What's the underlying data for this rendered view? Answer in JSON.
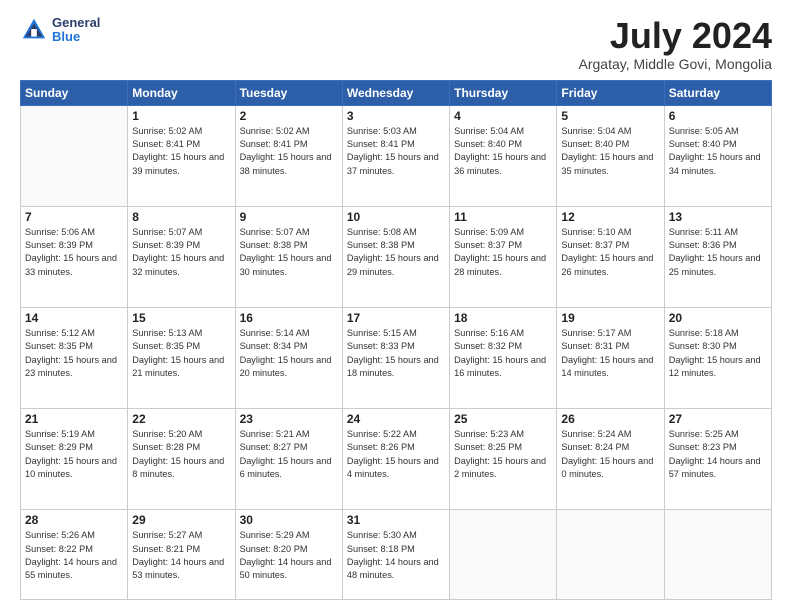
{
  "logo": {
    "general": "General",
    "blue": "Blue"
  },
  "header": {
    "month": "July 2024",
    "location": "Argatay, Middle Govi, Mongolia"
  },
  "weekdays": [
    "Sunday",
    "Monday",
    "Tuesday",
    "Wednesday",
    "Thursday",
    "Friday",
    "Saturday"
  ],
  "weeks": [
    [
      {
        "day": "",
        "sunrise": "",
        "sunset": "",
        "daylight": ""
      },
      {
        "day": "1",
        "sunrise": "Sunrise: 5:02 AM",
        "sunset": "Sunset: 8:41 PM",
        "daylight": "Daylight: 15 hours and 39 minutes."
      },
      {
        "day": "2",
        "sunrise": "Sunrise: 5:02 AM",
        "sunset": "Sunset: 8:41 PM",
        "daylight": "Daylight: 15 hours and 38 minutes."
      },
      {
        "day": "3",
        "sunrise": "Sunrise: 5:03 AM",
        "sunset": "Sunset: 8:41 PM",
        "daylight": "Daylight: 15 hours and 37 minutes."
      },
      {
        "day": "4",
        "sunrise": "Sunrise: 5:04 AM",
        "sunset": "Sunset: 8:40 PM",
        "daylight": "Daylight: 15 hours and 36 minutes."
      },
      {
        "day": "5",
        "sunrise": "Sunrise: 5:04 AM",
        "sunset": "Sunset: 8:40 PM",
        "daylight": "Daylight: 15 hours and 35 minutes."
      },
      {
        "day": "6",
        "sunrise": "Sunrise: 5:05 AM",
        "sunset": "Sunset: 8:40 PM",
        "daylight": "Daylight: 15 hours and 34 minutes."
      }
    ],
    [
      {
        "day": "7",
        "sunrise": "Sunrise: 5:06 AM",
        "sunset": "Sunset: 8:39 PM",
        "daylight": "Daylight: 15 hours and 33 minutes."
      },
      {
        "day": "8",
        "sunrise": "Sunrise: 5:07 AM",
        "sunset": "Sunset: 8:39 PM",
        "daylight": "Daylight: 15 hours and 32 minutes."
      },
      {
        "day": "9",
        "sunrise": "Sunrise: 5:07 AM",
        "sunset": "Sunset: 8:38 PM",
        "daylight": "Daylight: 15 hours and 30 minutes."
      },
      {
        "day": "10",
        "sunrise": "Sunrise: 5:08 AM",
        "sunset": "Sunset: 8:38 PM",
        "daylight": "Daylight: 15 hours and 29 minutes."
      },
      {
        "day": "11",
        "sunrise": "Sunrise: 5:09 AM",
        "sunset": "Sunset: 8:37 PM",
        "daylight": "Daylight: 15 hours and 28 minutes."
      },
      {
        "day": "12",
        "sunrise": "Sunrise: 5:10 AM",
        "sunset": "Sunset: 8:37 PM",
        "daylight": "Daylight: 15 hours and 26 minutes."
      },
      {
        "day": "13",
        "sunrise": "Sunrise: 5:11 AM",
        "sunset": "Sunset: 8:36 PM",
        "daylight": "Daylight: 15 hours and 25 minutes."
      }
    ],
    [
      {
        "day": "14",
        "sunrise": "Sunrise: 5:12 AM",
        "sunset": "Sunset: 8:35 PM",
        "daylight": "Daylight: 15 hours and 23 minutes."
      },
      {
        "day": "15",
        "sunrise": "Sunrise: 5:13 AM",
        "sunset": "Sunset: 8:35 PM",
        "daylight": "Daylight: 15 hours and 21 minutes."
      },
      {
        "day": "16",
        "sunrise": "Sunrise: 5:14 AM",
        "sunset": "Sunset: 8:34 PM",
        "daylight": "Daylight: 15 hours and 20 minutes."
      },
      {
        "day": "17",
        "sunrise": "Sunrise: 5:15 AM",
        "sunset": "Sunset: 8:33 PM",
        "daylight": "Daylight: 15 hours and 18 minutes."
      },
      {
        "day": "18",
        "sunrise": "Sunrise: 5:16 AM",
        "sunset": "Sunset: 8:32 PM",
        "daylight": "Daylight: 15 hours and 16 minutes."
      },
      {
        "day": "19",
        "sunrise": "Sunrise: 5:17 AM",
        "sunset": "Sunset: 8:31 PM",
        "daylight": "Daylight: 15 hours and 14 minutes."
      },
      {
        "day": "20",
        "sunrise": "Sunrise: 5:18 AM",
        "sunset": "Sunset: 8:30 PM",
        "daylight": "Daylight: 15 hours and 12 minutes."
      }
    ],
    [
      {
        "day": "21",
        "sunrise": "Sunrise: 5:19 AM",
        "sunset": "Sunset: 8:29 PM",
        "daylight": "Daylight: 15 hours and 10 minutes."
      },
      {
        "day": "22",
        "sunrise": "Sunrise: 5:20 AM",
        "sunset": "Sunset: 8:28 PM",
        "daylight": "Daylight: 15 hours and 8 minutes."
      },
      {
        "day": "23",
        "sunrise": "Sunrise: 5:21 AM",
        "sunset": "Sunset: 8:27 PM",
        "daylight": "Daylight: 15 hours and 6 minutes."
      },
      {
        "day": "24",
        "sunrise": "Sunrise: 5:22 AM",
        "sunset": "Sunset: 8:26 PM",
        "daylight": "Daylight: 15 hours and 4 minutes."
      },
      {
        "day": "25",
        "sunrise": "Sunrise: 5:23 AM",
        "sunset": "Sunset: 8:25 PM",
        "daylight": "Daylight: 15 hours and 2 minutes."
      },
      {
        "day": "26",
        "sunrise": "Sunrise: 5:24 AM",
        "sunset": "Sunset: 8:24 PM",
        "daylight": "Daylight: 15 hours and 0 minutes."
      },
      {
        "day": "27",
        "sunrise": "Sunrise: 5:25 AM",
        "sunset": "Sunset: 8:23 PM",
        "daylight": "Daylight: 14 hours and 57 minutes."
      }
    ],
    [
      {
        "day": "28",
        "sunrise": "Sunrise: 5:26 AM",
        "sunset": "Sunset: 8:22 PM",
        "daylight": "Daylight: 14 hours and 55 minutes."
      },
      {
        "day": "29",
        "sunrise": "Sunrise: 5:27 AM",
        "sunset": "Sunset: 8:21 PM",
        "daylight": "Daylight: 14 hours and 53 minutes."
      },
      {
        "day": "30",
        "sunrise": "Sunrise: 5:29 AM",
        "sunset": "Sunset: 8:20 PM",
        "daylight": "Daylight: 14 hours and 50 minutes."
      },
      {
        "day": "31",
        "sunrise": "Sunrise: 5:30 AM",
        "sunset": "Sunset: 8:18 PM",
        "daylight": "Daylight: 14 hours and 48 minutes."
      },
      {
        "day": "",
        "sunrise": "",
        "sunset": "",
        "daylight": ""
      },
      {
        "day": "",
        "sunrise": "",
        "sunset": "",
        "daylight": ""
      },
      {
        "day": "",
        "sunrise": "",
        "sunset": "",
        "daylight": ""
      }
    ]
  ]
}
